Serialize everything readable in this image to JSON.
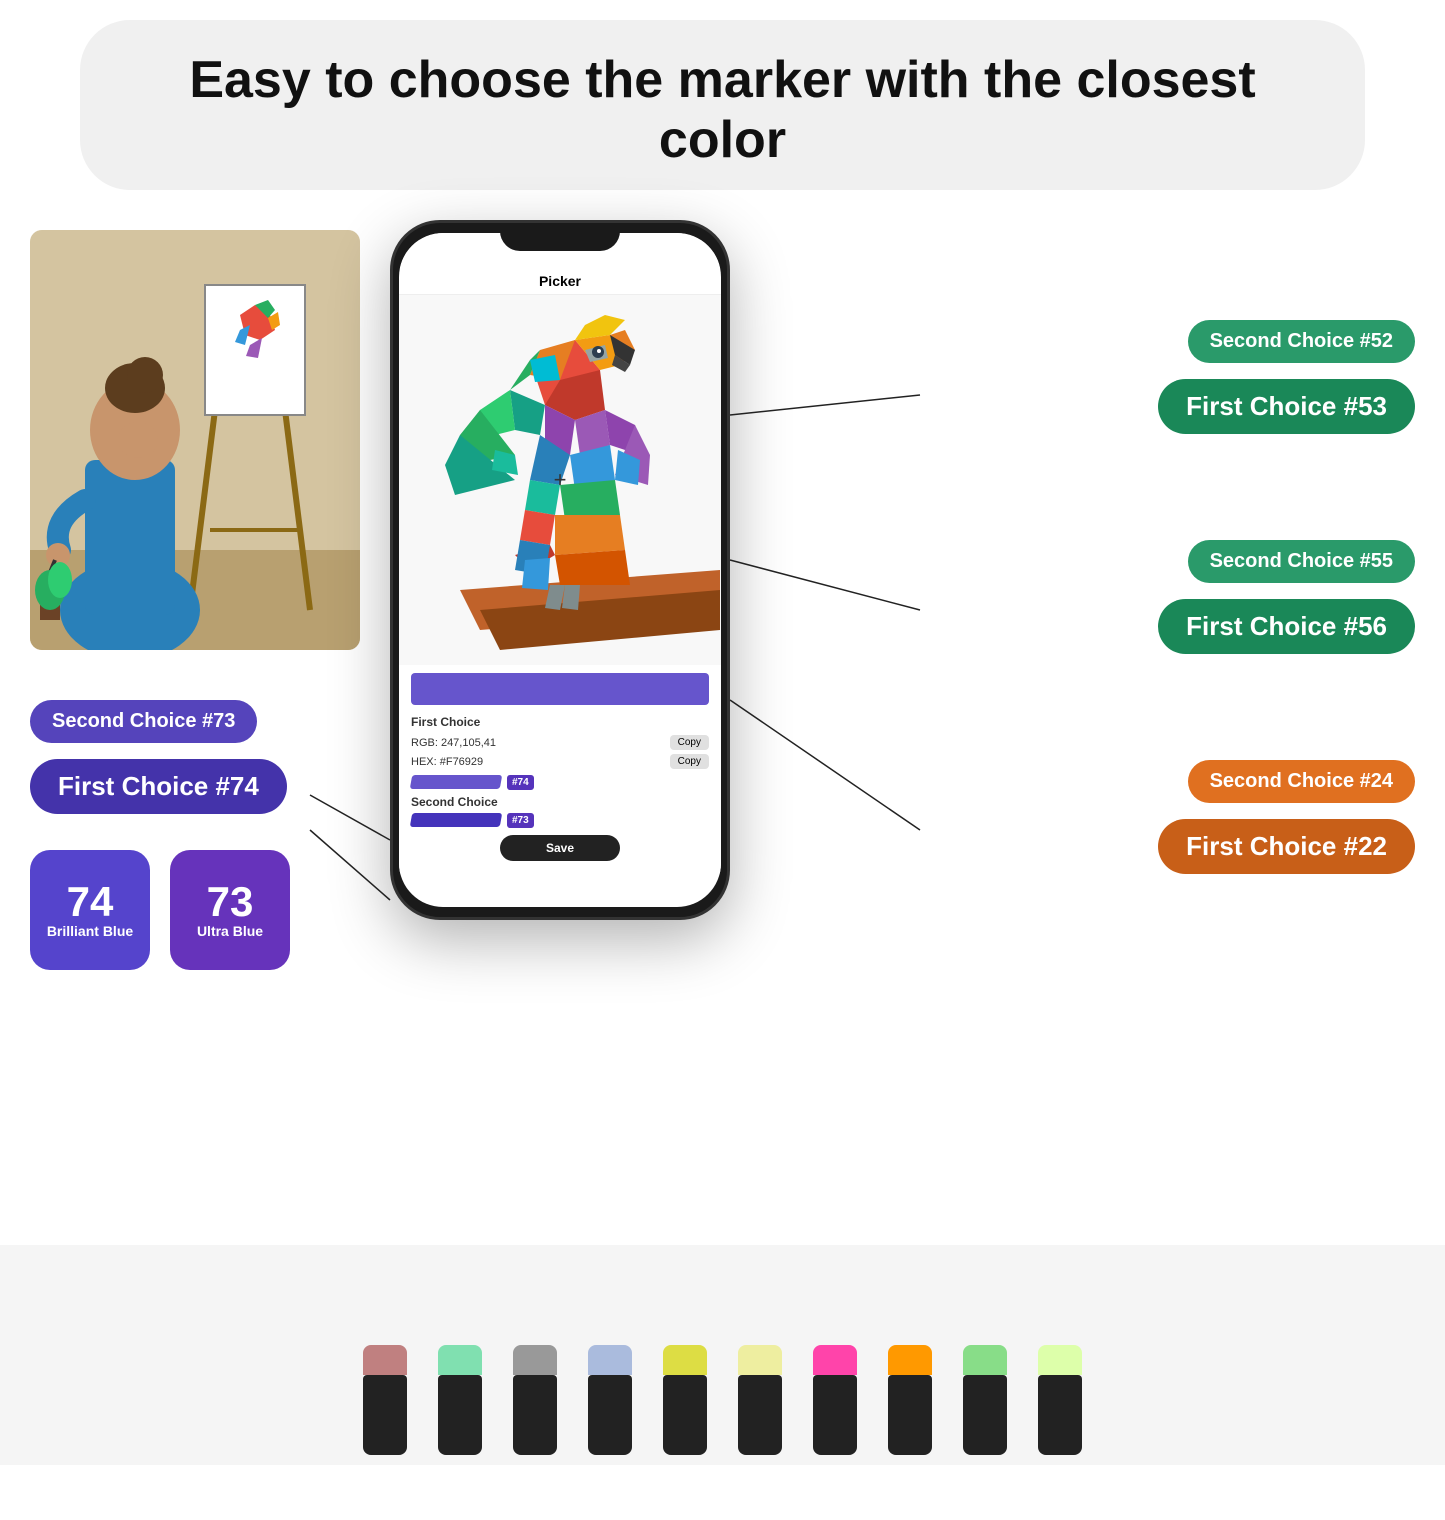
{
  "header": {
    "title": "Easy to choose the marker with the closest color"
  },
  "phone": {
    "app_name": "Picker",
    "first_choice_label": "First Choice",
    "second_choice_label": "Second Choice",
    "rgb_label": "RGB: 247,105,41",
    "hex_label": "HEX: #F76929",
    "copy_button": "Copy",
    "save_button": "Save",
    "marker_74": "#74",
    "marker_73": "#73"
  },
  "badges": {
    "right_top_second": "Second Choice #52",
    "right_top_first": "First Choice #53",
    "right_mid_second": "Second Choice #55",
    "right_mid_first": "First Choice #56",
    "right_bot_second": "Second Choice #24",
    "right_bot_first": "First Choice #22",
    "left_second": "Second Choice #73",
    "left_first": "First Choice #74"
  },
  "markers": {
    "chip_74_num": "74",
    "chip_74_name": "Brilliant Blue",
    "chip_73_num": "73",
    "chip_73_name": "Ultra Blue"
  },
  "colors": {
    "green_dark": "#1a8858",
    "green_mid": "#2a9a6a",
    "purple_dark": "#4433aa",
    "purple_mid": "#5544bb",
    "orange_dark": "#c85f18",
    "orange_mid": "#e07020",
    "chip_74": "#5544cc",
    "chip_73": "#6633bb",
    "marker_colors": [
      "#c08080",
      "#80c0a0",
      "#888888",
      "#9090bb",
      "#aabbcc",
      "#dddd44",
      "#ff88aa",
      "#ffaa00",
      "#88ddaa",
      "#ffff88"
    ]
  }
}
